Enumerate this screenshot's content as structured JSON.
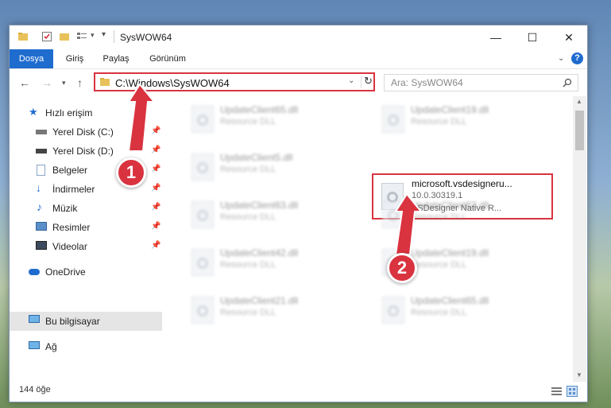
{
  "window": {
    "title": "SysWOW64",
    "controls": {
      "minimize": "—",
      "maximize": "☐",
      "close": "✕"
    }
  },
  "ribbon": {
    "tabs": [
      "Dosya",
      "Giriş",
      "Paylaş",
      "Görünüm"
    ],
    "help": "?"
  },
  "nav": {
    "address": "C:\\Windows\\SysWOW64",
    "search_placeholder": "Ara: SysWOW64"
  },
  "sidebar": {
    "items": [
      {
        "label": "Hızlı erişim",
        "icon": "star-icon",
        "pinned": false
      },
      {
        "label": "Yerel Disk (C:)",
        "icon": "drive-icon",
        "pinned": true
      },
      {
        "label": "Yerel Disk (D:)",
        "icon": "drive-icon",
        "pinned": true
      },
      {
        "label": "Belgeler",
        "icon": "documents-icon",
        "pinned": true
      },
      {
        "label": "İndirmeler",
        "icon": "download-icon",
        "pinned": true
      },
      {
        "label": "Müzik",
        "icon": "music-icon",
        "pinned": true
      },
      {
        "label": "Resimler",
        "icon": "pictures-icon",
        "pinned": true
      },
      {
        "label": "Videolar",
        "icon": "videos-icon",
        "pinned": true
      },
      {
        "label": "OneDrive",
        "icon": "cloud-icon",
        "pinned": false
      },
      {
        "label": "Bu bilgisayar",
        "icon": "computer-icon",
        "pinned": false
      },
      {
        "label": "Ağ",
        "icon": "network-icon",
        "pinned": false
      }
    ]
  },
  "files": [
    {
      "name": "UpdateClient65.dll",
      "type": "Resource DLL"
    },
    {
      "name": "UpdateClient19.dll",
      "type": "Resource DLL"
    },
    {
      "name": "UpdateClient5.dll",
      "type": "Resource DLL"
    },
    {
      "name": "microsoft.vsdesigneru...",
      "version": "10.0.30319.1",
      "type": "VSDesigner Native R..."
    },
    {
      "name": "UpdateClient63.dll",
      "type": "Resource DLL"
    },
    {
      "name": "UpdateClient63.dll",
      "type": "Resource DLL"
    },
    {
      "name": "UpdateClient42.dll",
      "type": "Resource DLL"
    },
    {
      "name": "UpdateClient19.dll",
      "type": "Resource DLL"
    },
    {
      "name": "UpdateClient21.dll",
      "type": "Resource DLL"
    },
    {
      "name": "UpdateClient65.dll",
      "type": "Resource DLL"
    }
  ],
  "status": {
    "count": "144 öğe"
  },
  "annotations": {
    "step1": "1",
    "step2": "2",
    "color": "#d9333f"
  }
}
